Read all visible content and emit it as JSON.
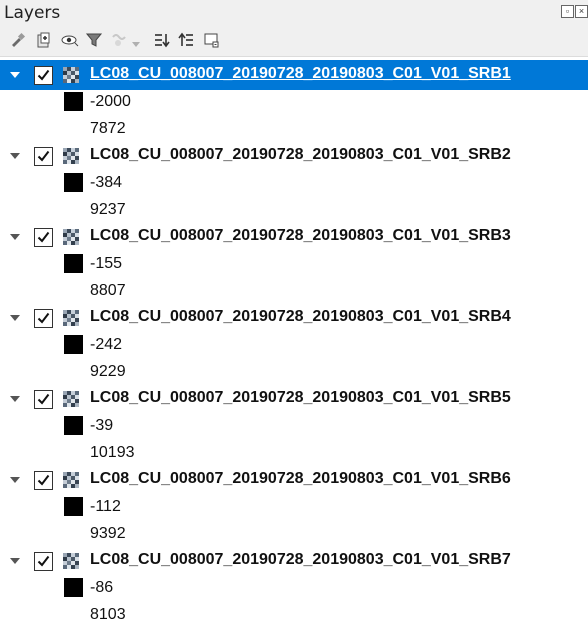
{
  "panel": {
    "title": "Layers",
    "float_icon": "float-panel-icon",
    "close_icon": "close-panel-icon"
  },
  "toolbar": {
    "buttons": [
      {
        "name": "open-layer-styling-icon"
      },
      {
        "name": "add-group-icon"
      },
      {
        "name": "manage-visibility-icon"
      },
      {
        "name": "filter-legend-icon"
      },
      {
        "name": "filter-by-expression-icon"
      },
      {
        "name": "expand-all-icon"
      },
      {
        "name": "collapse-all-icon"
      },
      {
        "name": "remove-layer-icon"
      }
    ]
  },
  "colors": {
    "selection": "#0078d7",
    "swatch": "#000000"
  },
  "layers": [
    {
      "name": "LC08_CU_008007_20190728_20190803_C01_V01_SRB1",
      "min": "-2000",
      "max": "7872",
      "checked": true,
      "selected": true
    },
    {
      "name": "LC08_CU_008007_20190728_20190803_C01_V01_SRB2",
      "min": "-384",
      "max": "9237",
      "checked": true,
      "selected": false
    },
    {
      "name": "LC08_CU_008007_20190728_20190803_C01_V01_SRB3",
      "min": "-155",
      "max": "8807",
      "checked": true,
      "selected": false
    },
    {
      "name": "LC08_CU_008007_20190728_20190803_C01_V01_SRB4",
      "min": "-242",
      "max": "9229",
      "checked": true,
      "selected": false
    },
    {
      "name": "LC08_CU_008007_20190728_20190803_C01_V01_SRB5",
      "min": "-39",
      "max": "10193",
      "checked": true,
      "selected": false
    },
    {
      "name": "LC08_CU_008007_20190728_20190803_C01_V01_SRB6",
      "min": "-112",
      "max": "9392",
      "checked": true,
      "selected": false
    },
    {
      "name": "LC08_CU_008007_20190728_20190803_C01_V01_SRB7",
      "min": "-86",
      "max": "8103",
      "checked": true,
      "selected": false
    }
  ]
}
